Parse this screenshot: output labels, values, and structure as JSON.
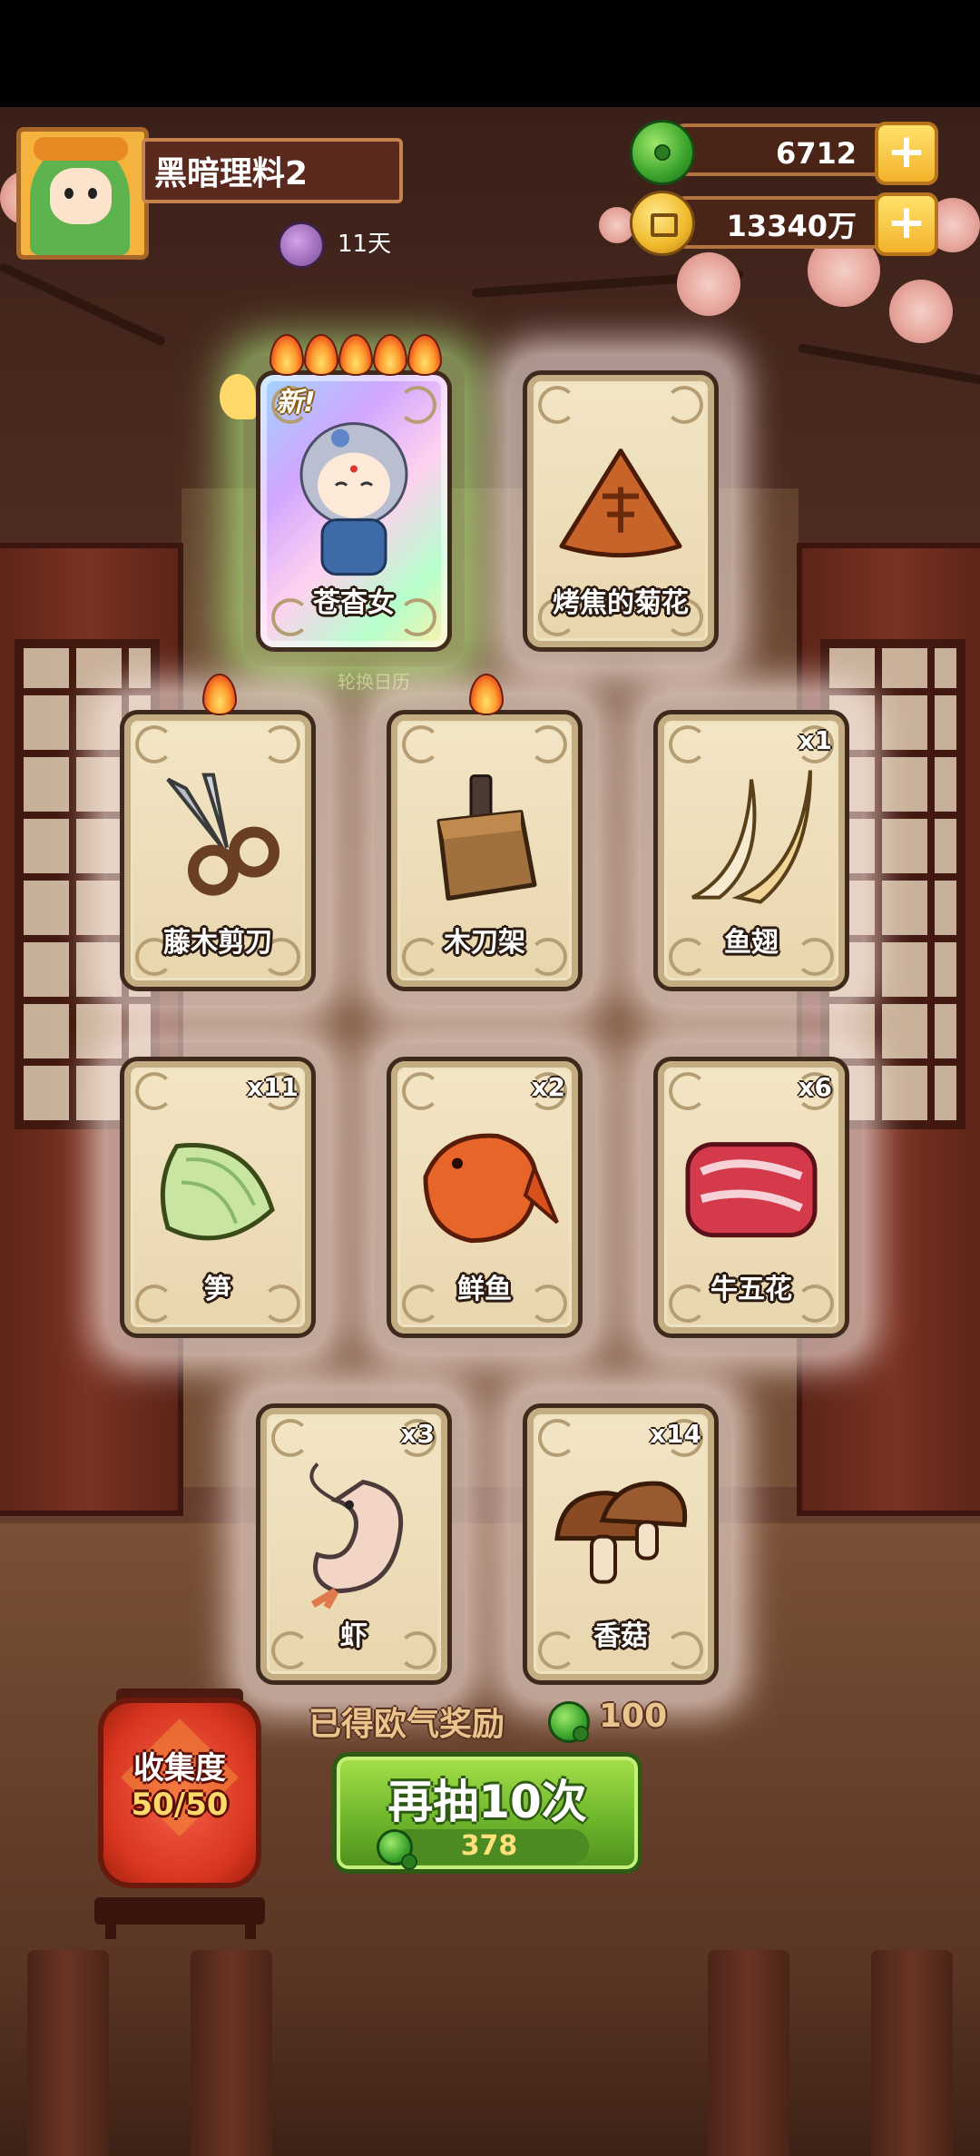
{
  "player": {
    "name": "黑暗理料2",
    "days": "11天",
    "avatar_icon": "chef-girl-avatar"
  },
  "resources": {
    "jade": {
      "icon": "jade-icon",
      "value": "6712"
    },
    "coins": {
      "icon": "coin-icon",
      "value": "13340万"
    },
    "plus_label": "+"
  },
  "new_badge": "新!",
  "banner_caption": "轮换日历",
  "cards": [
    {
      "name": "苍杳女",
      "count": "",
      "flames": 5,
      "rare": true,
      "is_new": true,
      "icon": "character-portrait-icon"
    },
    {
      "name": "烤焦的菊花",
      "count": "",
      "flames": 0,
      "rare": false,
      "is_new": false,
      "icon": "burnt-dumpling-icon"
    },
    {
      "name": "藤木剪刀",
      "count": "",
      "flames": 1,
      "rare": false,
      "is_new": false,
      "icon": "scissors-icon"
    },
    {
      "name": "木刀架",
      "count": "",
      "flames": 1,
      "rare": false,
      "is_new": false,
      "icon": "knife-block-icon"
    },
    {
      "name": "鱼翅",
      "count": "x1",
      "flames": 0,
      "rare": false,
      "is_new": false,
      "icon": "shark-fin-icon"
    },
    {
      "name": "笋",
      "count": "x11",
      "flames": 0,
      "rare": false,
      "is_new": false,
      "icon": "bamboo-shoot-icon"
    },
    {
      "name": "鲜鱼",
      "count": "x2",
      "flames": 0,
      "rare": false,
      "is_new": false,
      "icon": "fish-icon"
    },
    {
      "name": "牛五花",
      "count": "x6",
      "flames": 0,
      "rare": false,
      "is_new": false,
      "icon": "beef-icon"
    },
    {
      "name": "虾",
      "count": "x3",
      "flames": 0,
      "rare": false,
      "is_new": false,
      "icon": "shrimp-icon"
    },
    {
      "name": "香菇",
      "count": "x14",
      "flames": 0,
      "rare": false,
      "is_new": false,
      "icon": "mushroom-icon"
    }
  ],
  "reward": {
    "label": "已得欧气奖励",
    "value": "100"
  },
  "draw_button": {
    "label": "再抽10次",
    "cost": "378"
  },
  "collection": {
    "label": "收集度",
    "value": "50/50"
  },
  "colors": {
    "accent_green": "#6ab32a",
    "card_bg": "#f3e6c6",
    "lantern_red": "#d8351f",
    "gold": "#f3b22b"
  }
}
